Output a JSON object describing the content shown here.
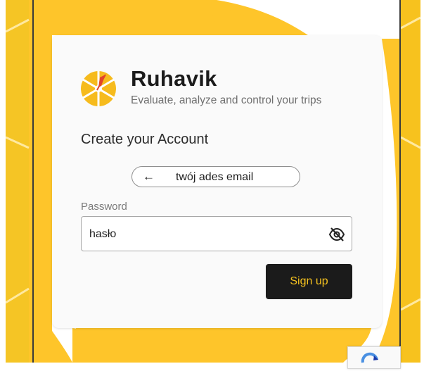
{
  "brand": {
    "name": "Ruhavik",
    "tagline": "Evaluate, analyze and control your trips"
  },
  "form": {
    "heading": "Create your Account",
    "email_chip": {
      "arrow": "←",
      "value": "twój ades email"
    },
    "password_label": "Password",
    "password_value": "hasło",
    "signup_label": "Sign up"
  },
  "colors": {
    "background": "#fec52a",
    "button": "#1b1b1b",
    "button_text": "#f4c11f"
  },
  "icons": [
    "logo-icon",
    "back-arrow-icon",
    "eye-slash-icon",
    "recaptcha-icon"
  ]
}
